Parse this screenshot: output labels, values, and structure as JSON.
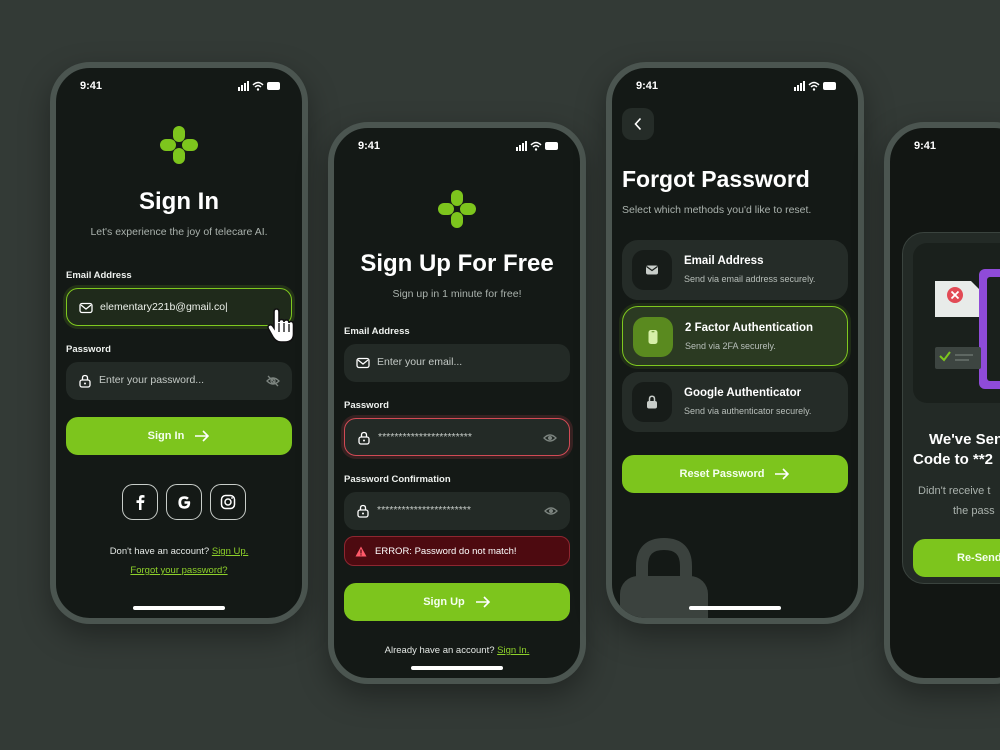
{
  "status": {
    "time": "9:41"
  },
  "signin": {
    "title": "Sign In",
    "subtitle": "Let's experience the joy of telecare AI.",
    "email_label": "Email Address",
    "email_value": "elementary221b@gmail.co|",
    "password_label": "Password",
    "password_placeholder": "Enter your password...",
    "button_label": "Sign In",
    "social": [
      "facebook-icon",
      "google-icon",
      "instagram-icon"
    ],
    "no_account_text": "Don't have an account?",
    "signup_link": "Sign Up.",
    "forgot_link": "Forgot your password?"
  },
  "signup": {
    "title": "Sign Up For Free",
    "subtitle": "Sign up in 1 minute for free!",
    "email_label": "Email Address",
    "email_placeholder": "Enter your email...",
    "password_label": "Password",
    "password_value": "***********************",
    "confirm_label": "Password Confirmation",
    "confirm_value": "***********************",
    "error_text": "ERROR: Password do not match!",
    "button_label": "Sign Up",
    "have_account_text": "Already have an account?",
    "signin_link": "Sign In."
  },
  "forgot": {
    "title": "Forgot Password",
    "subtitle": "Select which methods you'd like to reset.",
    "methods": [
      {
        "title": "Email Address",
        "subtitle": "Send via email address securely."
      },
      {
        "title": "2 Factor Authentication",
        "subtitle": "Send via 2FA securely."
      },
      {
        "title": "Google Authenticator",
        "subtitle": "Send via authenticator securely."
      }
    ],
    "button_label": "Reset Password"
  },
  "sent": {
    "title_line1": "We've Sen",
    "title_line2": "Code to **2",
    "subtitle_line1": "Didn't receive t",
    "subtitle_line2": "the pass",
    "button_label": "Re-Send"
  },
  "colors": {
    "background": "#333a36",
    "phone_bg": "#141916",
    "accent": "#7dc51d",
    "error": "#d14a55"
  }
}
